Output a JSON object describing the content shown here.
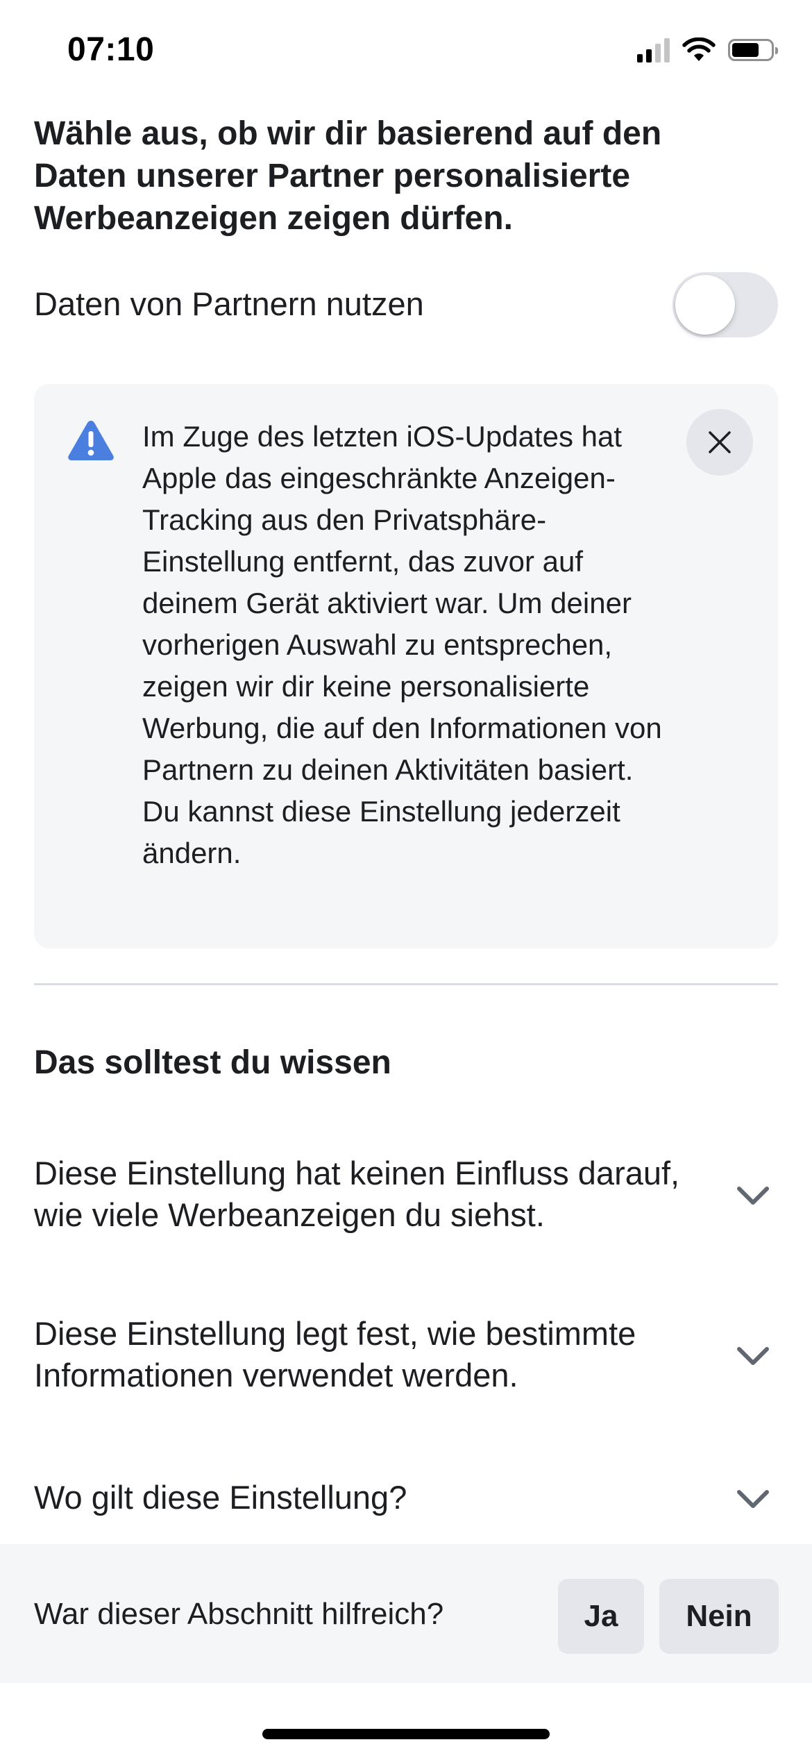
{
  "status_bar": {
    "time": "07:10",
    "icons": [
      "cellular-signal-icon",
      "wifi-icon",
      "battery-icon"
    ]
  },
  "headline": "Wähle aus, ob wir dir basierend auf den Daten unserer Partner personalisierte Werbeanzeigen zeigen dürfen.",
  "toggle": {
    "label": "Daten von Partnern nutzen",
    "state": "off"
  },
  "notice": {
    "icon": "warning-triangle-icon",
    "icon_color": "#4a7fe0",
    "text": "Im Zuge des letzten iOS-Updates hat Apple das eingeschränkte Anzeigen-Tracking aus den Privatsphäre-Einstellung entfernt, das zuvor auf deinem Gerät aktiviert war. Um deiner vorherigen Auswahl zu entsprechen, zeigen wir dir keine personalisierte Werbung, die auf den Informationen von Partnern zu deinen Aktivitäten basiert. Du kannst diese Einstellung jederzeit ändern.",
    "close_icon": "close-icon"
  },
  "section": {
    "title": "Das solltest du wissen",
    "items": [
      {
        "text": "Diese Einstellung hat keinen Einfluss darauf, wie viele Werbeanzeigen du siehst.",
        "icon": "chevron-down-icon"
      },
      {
        "text": "Diese Einstellung legt fest, wie bestimmte Informationen verwendet werden.",
        "icon": "chevron-down-icon"
      },
      {
        "text": "Wo gilt diese Einstellung?",
        "icon": "chevron-down-icon"
      }
    ]
  },
  "feedback": {
    "question": "War dieser Abschnitt hilfreich?",
    "yes_label": "Ja",
    "no_label": "Nein"
  },
  "colors": {
    "text": "#1c1e21",
    "card_background": "#f5f6f7",
    "button_background": "#e4e6eb",
    "divider": "#dadde1"
  }
}
